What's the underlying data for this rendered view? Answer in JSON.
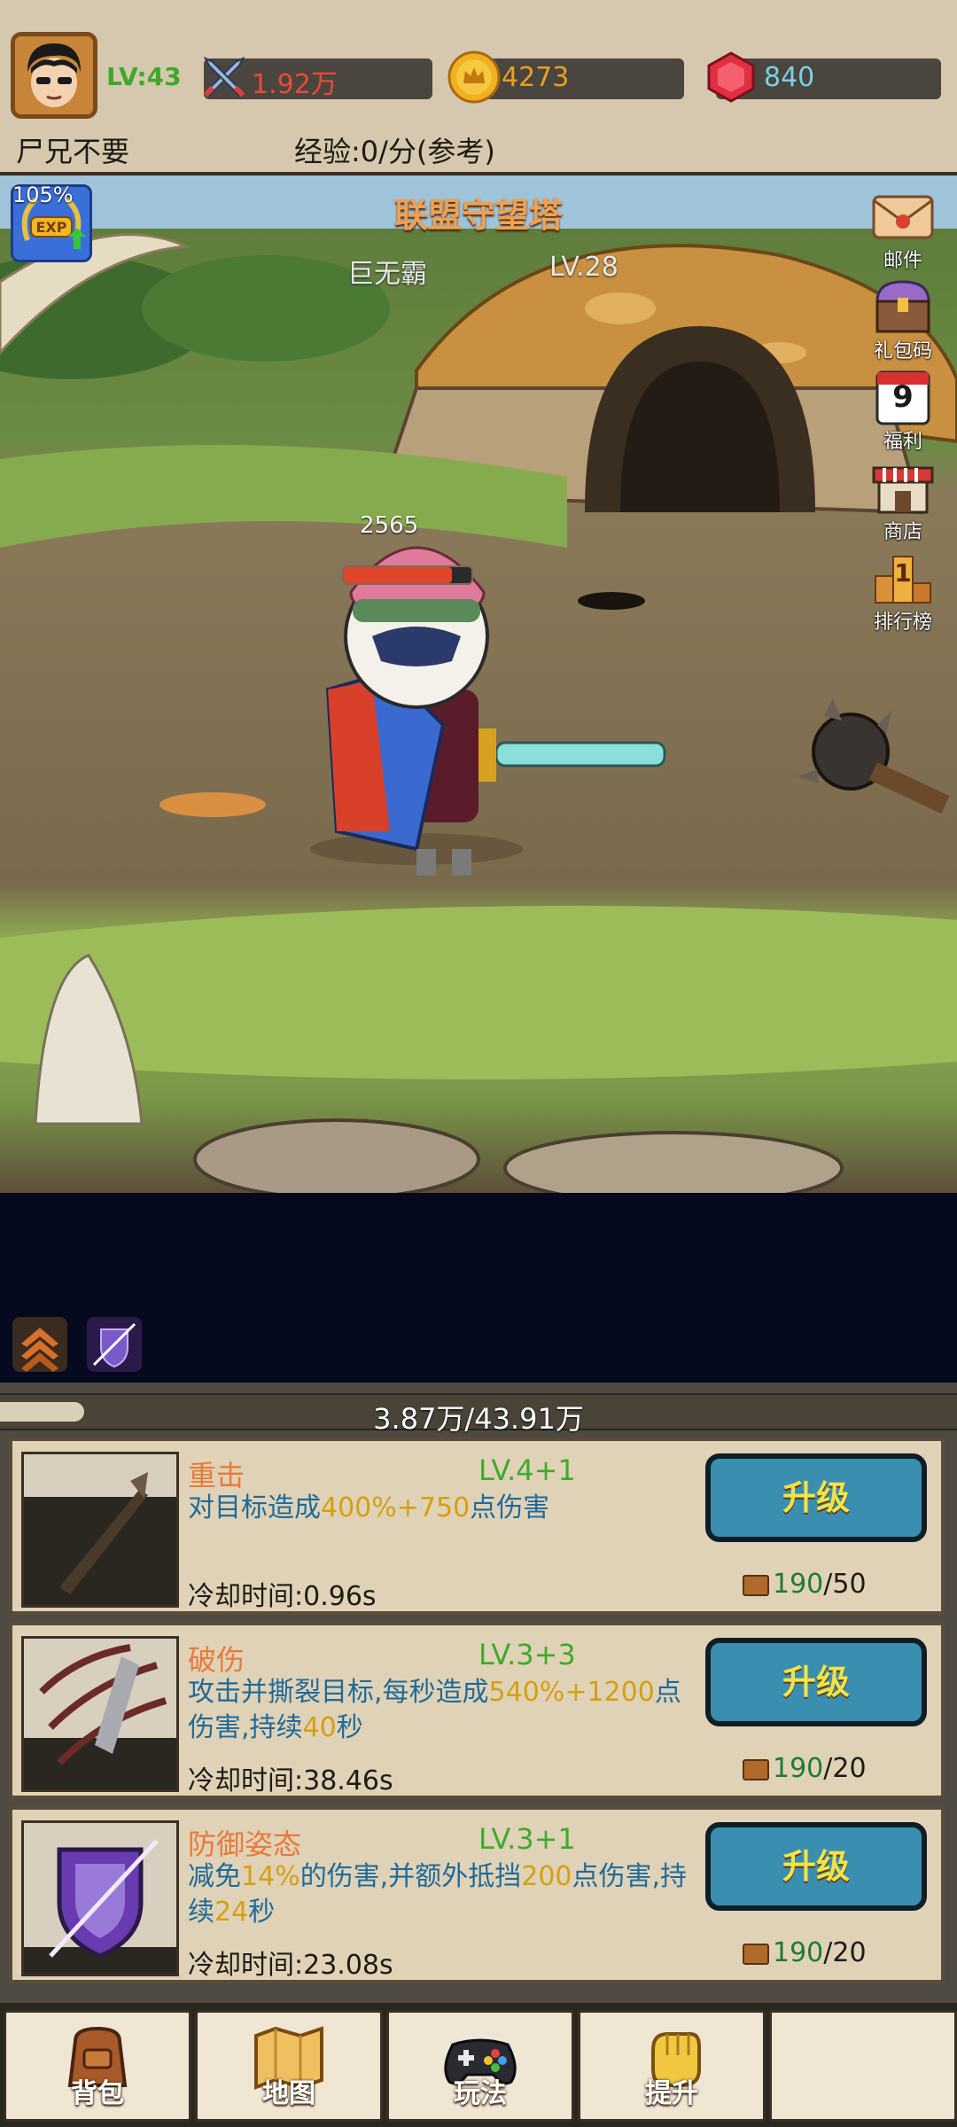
{
  "header": {
    "level": "LV:43",
    "power": "1.92万",
    "gold": "4273",
    "gems": "840",
    "player_name": "尸兄不要",
    "exp_rate": "经验:0/分(参考)"
  },
  "scene": {
    "title": "联盟守望塔",
    "boss_name": "巨无霸",
    "boss_level": "LV.28",
    "exp_boost": "105%",
    "enemy_hp": "2565",
    "enemy_hp_fraction": 0.85,
    "side_menu": [
      {
        "label": "邮件",
        "icon": "mail-icon"
      },
      {
        "label": "礼包码",
        "icon": "treasure-chest-icon"
      },
      {
        "label": "福利",
        "icon": "calendar-icon",
        "badge": "9"
      },
      {
        "label": "商店",
        "icon": "shop-icon"
      },
      {
        "label": "排行榜",
        "icon": "ranking-icon",
        "badge": "1"
      }
    ]
  },
  "progress": {
    "text": "3.87万/43.91万",
    "fraction": 0.088
  },
  "skills": [
    {
      "name": "重击",
      "level": "LV.4+1",
      "desc_parts": [
        "对目标造成",
        "400%+750",
        "点伤害"
      ],
      "cooldown": "冷却时间:0.96s",
      "button": "升级",
      "cost_have": "190",
      "cost_need": "/50"
    },
    {
      "name": "破伤",
      "level": "LV.3+3",
      "desc_parts": [
        "攻击并撕裂目标,每秒造成",
        "540%+1200",
        "点伤害,持续",
        "40",
        "秒"
      ],
      "cooldown": "冷却时间:38.46s",
      "button": "升级",
      "cost_have": "190",
      "cost_need": "/20"
    },
    {
      "name": "防御姿态",
      "level": "LV.3+1",
      "desc_parts": [
        "减免",
        "14%",
        "的伤害,并额外抵挡",
        "200",
        "点伤害,持续",
        "24",
        "秒"
      ],
      "cooldown": "冷却时间:23.08s",
      "button": "升级",
      "cost_have": "190",
      "cost_need": "/20"
    }
  ],
  "nav": [
    {
      "label": "背包",
      "icon": "backpack-icon"
    },
    {
      "label": "地图",
      "icon": "map-icon"
    },
    {
      "label": "玩法",
      "icon": "gamepad-icon"
    },
    {
      "label": "提升",
      "icon": "fist-icon"
    }
  ],
  "colors": {
    "header_bg": "#d6c8ae",
    "skill_name": "#e87a3a",
    "skill_level": "#3faa2c",
    "skill_desc": "#1e6a9a",
    "highlight": "#d4a012",
    "upgrade_button": "#3a8fb0"
  }
}
